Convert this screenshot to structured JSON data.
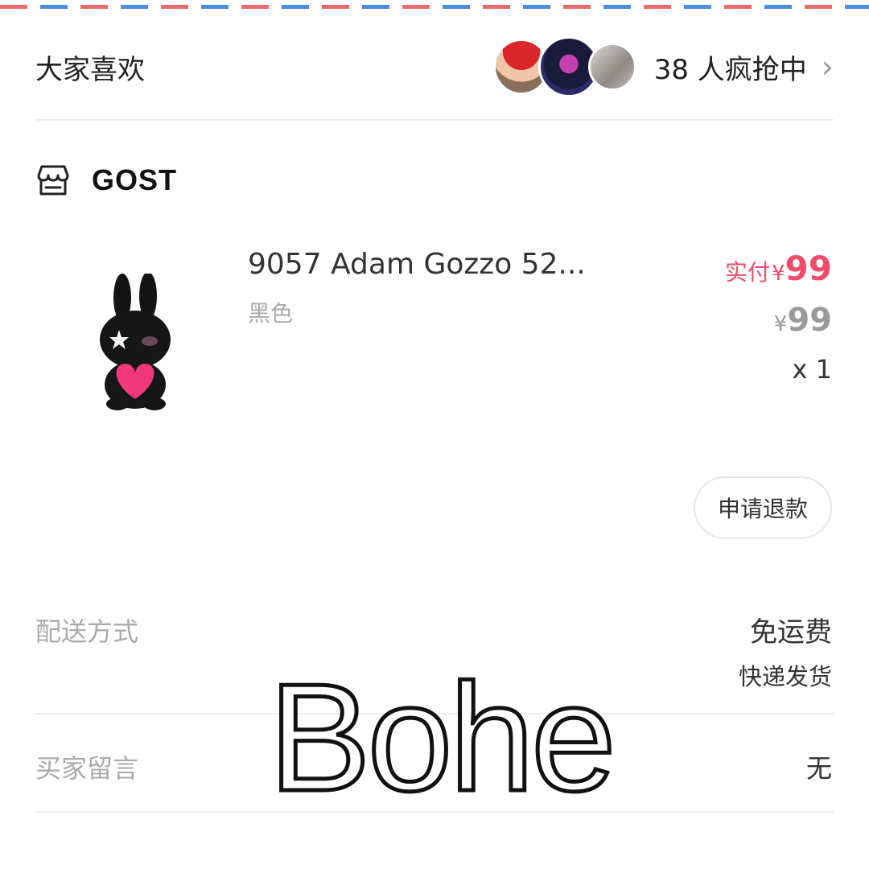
{
  "likes": {
    "title": "大家喜欢",
    "rush_text": "38 人疯抢中",
    "chevron": "›"
  },
  "shop": {
    "name": "GOST",
    "icon": "store-icon"
  },
  "product": {
    "title": "9057 Adam Gozzo 52...",
    "variant": "黑色",
    "paid_label": "实付",
    "currency": "¥",
    "paid_price": "99",
    "original_price": "99",
    "quantity": "x 1",
    "image_icon": "bunny-plush-icon"
  },
  "actions": {
    "refund_label": "申请退款"
  },
  "shipping": {
    "label": "配送方式",
    "value": "免运费",
    "sub_value": "快递发货"
  },
  "buyer_message": {
    "label": "买家留言",
    "value": "无"
  },
  "watermark": "Bohe",
  "colors": {
    "price_accent": "#f24a6a",
    "muted_text": "#aaaaaa",
    "airmail_red": "#e86a6a",
    "airmail_blue": "#4a8ee0"
  }
}
